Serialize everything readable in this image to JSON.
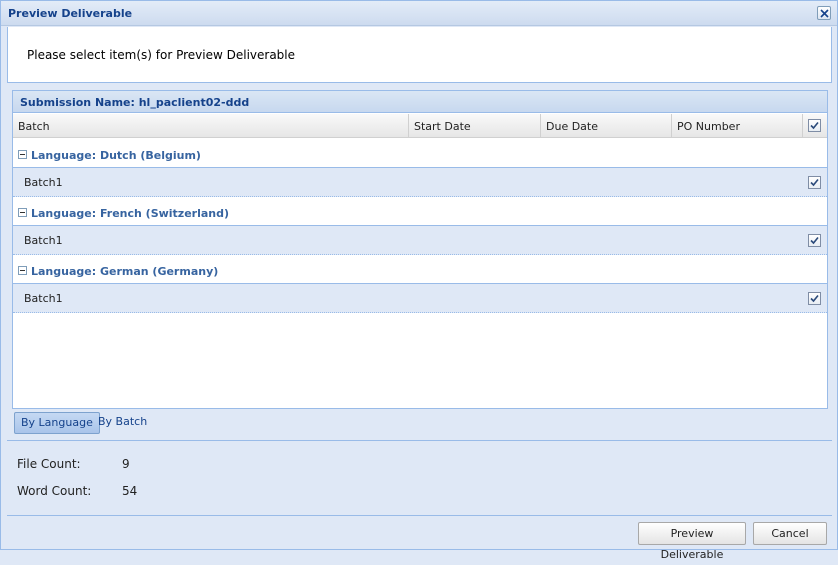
{
  "window": {
    "title": "Preview Deliverable"
  },
  "instruction": "Please select item(s) for Preview Deliverable",
  "grid": {
    "submission_name": "Submission Name: hl_paclient02-ddd",
    "columns": {
      "batch": "Batch",
      "start_date": "Start Date",
      "due_date": "Due Date",
      "po_number": "PO Number"
    },
    "groups": [
      {
        "label": "Language: Dutch (Belgium)",
        "rows": [
          {
            "batch": "Batch1",
            "checked": true
          }
        ]
      },
      {
        "label": "Language: French (Switzerland)",
        "rows": [
          {
            "batch": "Batch1",
            "checked": true
          }
        ]
      },
      {
        "label": "Language: German (Germany)",
        "rows": [
          {
            "batch": "Batch1",
            "checked": true
          }
        ]
      }
    ]
  },
  "tabs": {
    "by_language": "By Language",
    "by_batch": "By Batch"
  },
  "stats": {
    "file_count_label": "File Count:",
    "file_count_value": "9",
    "word_count_label": "Word Count:",
    "word_count_value": "54"
  },
  "buttons": {
    "preview": "Preview Deliverable",
    "cancel": "Cancel"
  }
}
